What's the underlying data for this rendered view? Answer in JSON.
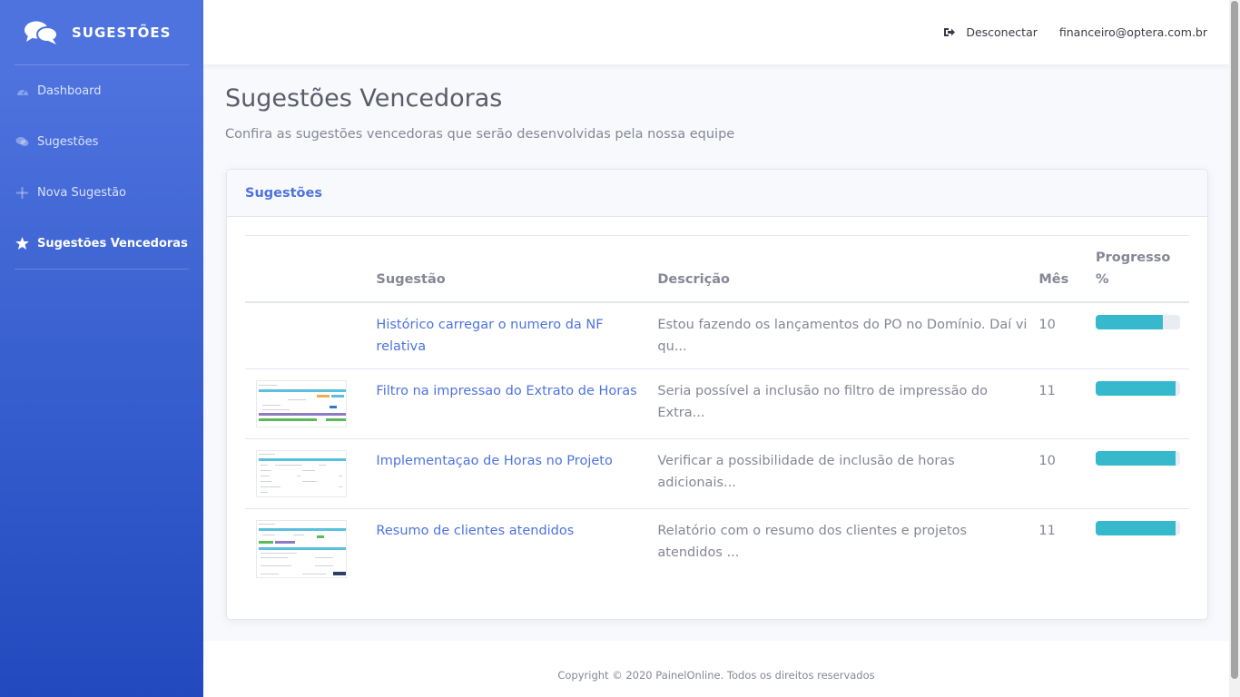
{
  "brand": {
    "name": "SUGESTÕES",
    "icon": "comments-icon"
  },
  "sidebar": {
    "items": [
      {
        "label": "Dashboard",
        "icon": "tachometer-icon",
        "active": false
      },
      {
        "label": "Sugestões",
        "icon": "comments-icon",
        "active": false
      },
      {
        "label": "Nova Sugestão",
        "icon": "plus-icon",
        "active": false
      },
      {
        "label": "Sugestões Vencedoras",
        "icon": "star-icon",
        "active": true
      }
    ]
  },
  "topbar": {
    "logout_label": "Desconectar",
    "logout_icon": "sign-out-icon",
    "user_email": "financeiro@optera.com.br"
  },
  "page": {
    "title": "Sugestões Vencedoras",
    "subtitle": "Confira as sugestões vencedoras que serão desenvolvidas pela nossa equipe"
  },
  "card": {
    "title": "Sugestões",
    "columns": {
      "image": "",
      "suggestion": "Sugestão",
      "description": "Descrição",
      "month": "Mês",
      "progress": "Progresso %"
    },
    "rows": [
      {
        "has_image": false,
        "suggestion": "Histórico carregar o numero da NF relativa",
        "description": "Estou fazendo os lançamentos do PO no Domínio. Daí vi qu...",
        "month": "10",
        "progress": 0.8
      },
      {
        "has_image": true,
        "suggestion": "Filtro na impressao do Extrato de Horas",
        "description": "Seria possível a inclusão no filtro de impressão do Extra...",
        "month": "11",
        "progress": 0.95
      },
      {
        "has_image": true,
        "suggestion": "Implementaçao de Horas no Projeto",
        "description": "Verificar a possibilidade de inclusão de horas adicionais...",
        "month": "10",
        "progress": 0.95
      },
      {
        "has_image": true,
        "suggestion": "Resumo de clientes atendidos",
        "description": "Relatório com o resumo dos clientes e projetos atendidos ...",
        "month": "11",
        "progress": 0.95
      }
    ]
  },
  "footer": {
    "text": "Copyright © 2020 PainelOnline. Todos os direitos reservados"
  },
  "colors": {
    "primary": "#4e73df",
    "sidebar_end": "#224abe",
    "progress": "#36b9cc"
  }
}
